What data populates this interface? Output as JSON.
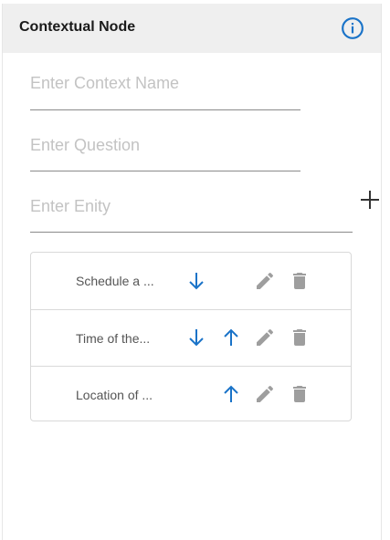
{
  "header": {
    "title": "Contextual Node",
    "info_icon": "info-icon"
  },
  "form": {
    "context_name_placeholder": "Enter Context Name",
    "question_placeholder": "Enter Question",
    "entity_placeholder": "Enter Enity",
    "add_icon": "plus-icon"
  },
  "list": {
    "items": [
      {
        "label": "Schedule a ...",
        "actions": [
          "arrow-down-icon",
          "pencil-icon",
          "trash-icon"
        ]
      },
      {
        "label": "Time of the...",
        "actions": [
          "arrow-down-icon",
          "arrow-up-icon",
          "pencil-icon",
          "trash-icon"
        ]
      },
      {
        "label": "Location of ...",
        "actions": [
          "arrow-up-icon",
          "pencil-icon",
          "trash-icon"
        ]
      }
    ]
  },
  "colors": {
    "accent": "#1a73c8",
    "icon_gray": "#9e9e9e",
    "header_bg": "#efefef"
  }
}
